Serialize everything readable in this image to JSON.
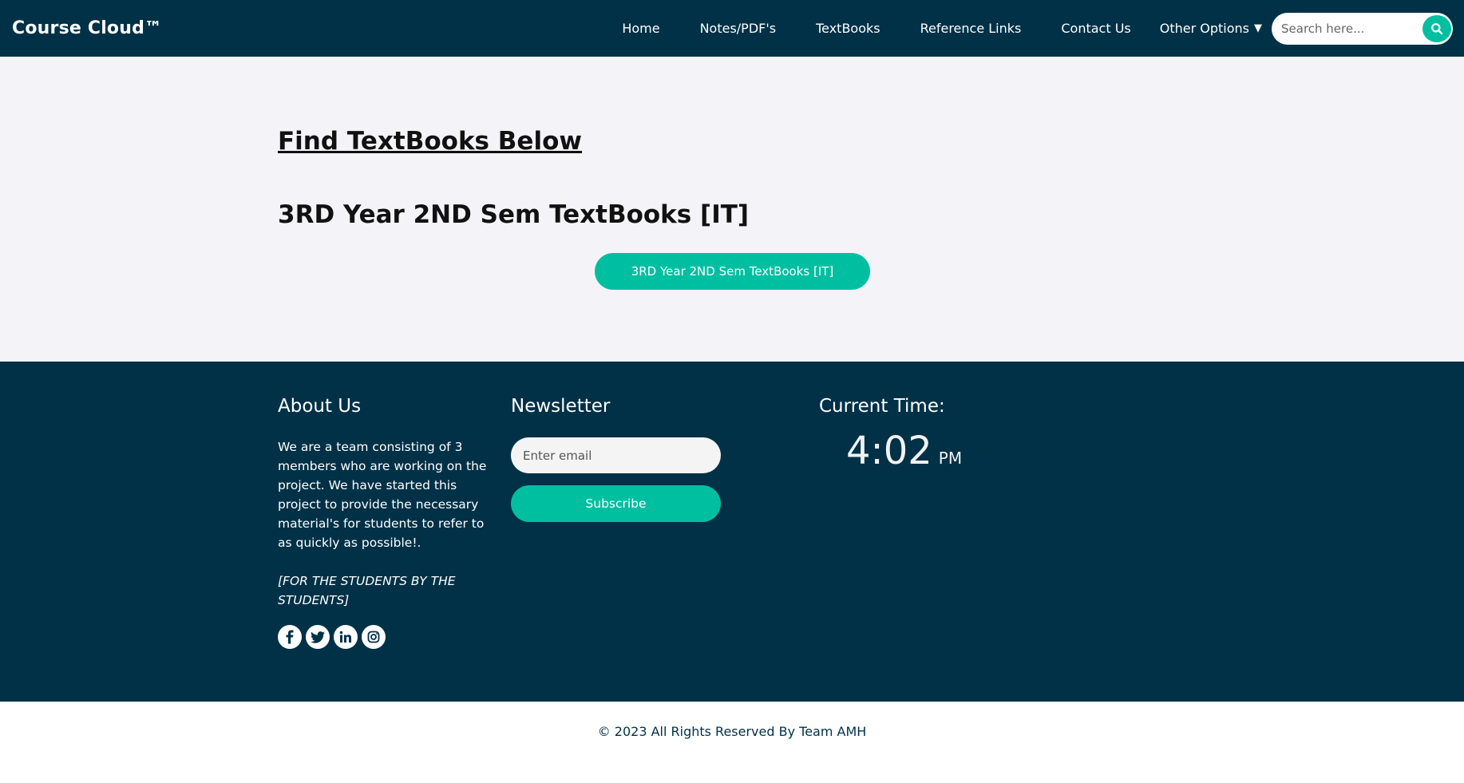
{
  "navbar": {
    "brand": "Course Cloud™",
    "links": [
      "Home",
      "Notes/PDF's",
      "TextBooks",
      "Reference Links",
      "Contact Us"
    ],
    "dropdown_label": "Other Options",
    "search_placeholder": "Search here..."
  },
  "main": {
    "title": "Find TextBooks Below",
    "section_heading": "3RD Year 2ND Sem TextBooks [IT]",
    "button_label": "3RD Year 2ND Sem TextBooks [IT]"
  },
  "footer": {
    "about_title": "About Us",
    "about_text": "We are a team consisting of 3 members who are working on the project. We have started this project to provide the necessary material's for students to refer to as quickly as possible!.",
    "about_motto": "[FOR THE STUDENTS BY THE STUDENTS]",
    "social_icons": [
      "facebook-icon",
      "twitter-icon",
      "linkedin-icon",
      "instagram-icon"
    ],
    "newsletter_title": "Newsletter",
    "email_placeholder": "Enter email",
    "subscribe_label": "Subscribe",
    "time_title": "Current Time:",
    "time_value": "4:02",
    "time_ampm": "PM"
  },
  "copyright": "© 2023 All Rights Reserved By Team AMH",
  "colors": {
    "navy": "#003147",
    "accent": "#00bfa0",
    "page_bg": "#f4f4f8"
  }
}
